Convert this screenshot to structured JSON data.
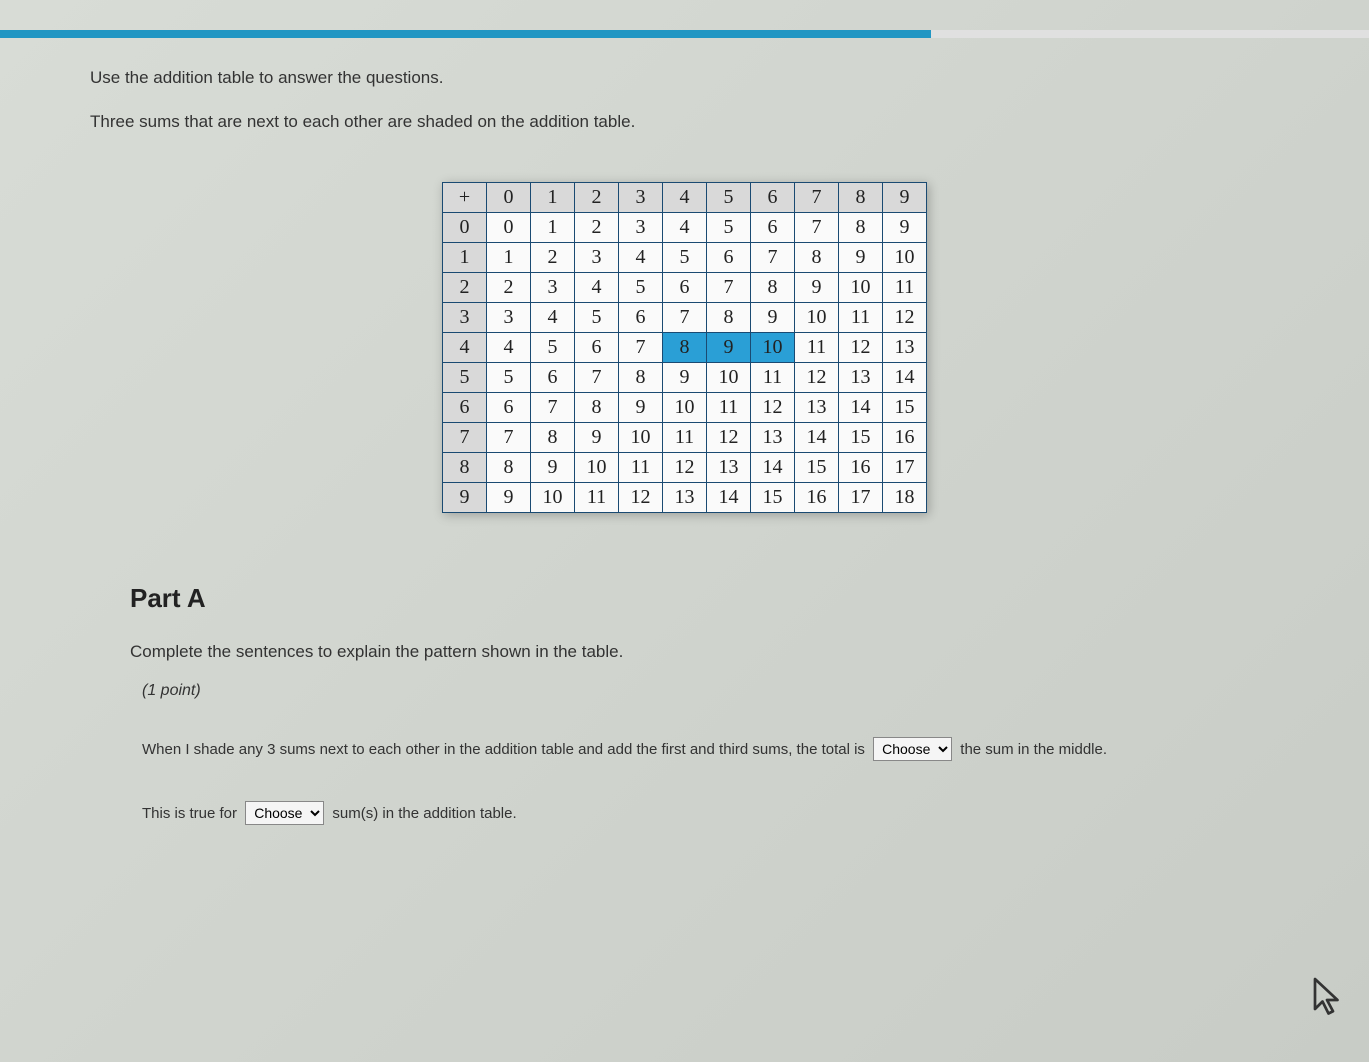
{
  "instructions": {
    "line1": "Use the addition table to answer the questions.",
    "line2": "Three sums that are next to each other are shaded on the addition table."
  },
  "table": {
    "corner": "+",
    "col_headers": [
      "0",
      "1",
      "2",
      "3",
      "4",
      "5",
      "6",
      "7",
      "8",
      "9"
    ],
    "row_headers": [
      "0",
      "1",
      "2",
      "3",
      "4",
      "5",
      "6",
      "7",
      "8",
      "9"
    ],
    "rows": [
      [
        "0",
        "1",
        "2",
        "3",
        "4",
        "5",
        "6",
        "7",
        "8",
        "9"
      ],
      [
        "1",
        "2",
        "3",
        "4",
        "5",
        "6",
        "7",
        "8",
        "9",
        "10"
      ],
      [
        "2",
        "3",
        "4",
        "5",
        "6",
        "7",
        "8",
        "9",
        "10",
        "11"
      ],
      [
        "3",
        "4",
        "5",
        "6",
        "7",
        "8",
        "9",
        "10",
        "11",
        "12"
      ],
      [
        "4",
        "5",
        "6",
        "7",
        "8",
        "9",
        "10",
        "11",
        "12",
        "13"
      ],
      [
        "5",
        "6",
        "7",
        "8",
        "9",
        "10",
        "11",
        "12",
        "13",
        "14"
      ],
      [
        "6",
        "7",
        "8",
        "9",
        "10",
        "11",
        "12",
        "13",
        "14",
        "15"
      ],
      [
        "7",
        "8",
        "9",
        "10",
        "11",
        "12",
        "13",
        "14",
        "15",
        "16"
      ],
      [
        "8",
        "9",
        "10",
        "11",
        "12",
        "13",
        "14",
        "15",
        "16",
        "17"
      ],
      [
        "9",
        "10",
        "11",
        "12",
        "13",
        "14",
        "15",
        "16",
        "17",
        "18"
      ]
    ],
    "shaded": [
      [
        4,
        4
      ],
      [
        4,
        5
      ],
      [
        4,
        6
      ]
    ]
  },
  "partA": {
    "heading": "Part A",
    "instruction": "Complete the sentences to explain the pattern shown in the table.",
    "points": "(1 point)",
    "sentence1_a": "When I shade any 3 sums next to each other in the addition table and add the first and third sums, the total is ",
    "sentence1_b": " the sum in the middle.",
    "sentence2_a": "This is true for ",
    "sentence2_b": " sum(s) in the addition table.",
    "dropdown_placeholder": "Choose"
  }
}
